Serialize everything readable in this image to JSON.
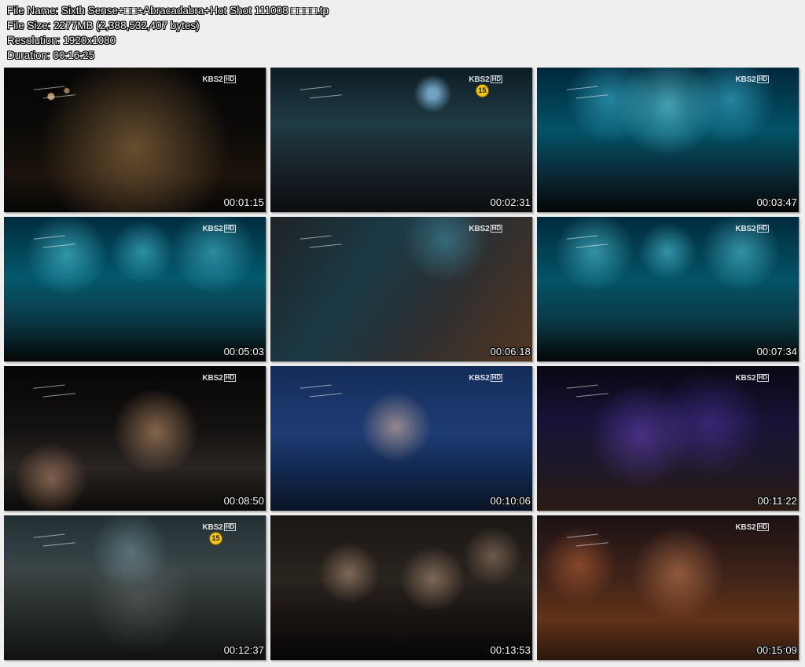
{
  "file_info": {
    "name_line": "File Name: Sixth Sense+□□+Abracadabra+Hot Shot 111008 □□□□.tp",
    "size_line": "File Size: 2277MB (2,388,532,407 bytes)",
    "resolution_line": "Resolution: 1920x1080",
    "duration_line": "Duration: 00:16:25"
  },
  "thumbnails": [
    {
      "timestamp": "00:01:15",
      "channel": "KBS2",
      "hd": "HD",
      "age_rating": "",
      "scene": "dance-stage-dark"
    },
    {
      "timestamp": "00:02:31",
      "channel": "KBS2",
      "hd": "HD",
      "age_rating": "15",
      "scene": "dance-stage-wide"
    },
    {
      "timestamp": "00:03:47",
      "channel": "KBS2",
      "hd": "HD",
      "age_rating": "",
      "scene": "interview-blue"
    },
    {
      "timestamp": "00:05:03",
      "channel": "KBS2",
      "hd": "HD",
      "age_rating": "",
      "scene": "interview-blue-close"
    },
    {
      "timestamp": "00:06:18",
      "channel": "KBS2",
      "hd": "HD",
      "age_rating": "",
      "scene": "interview-side"
    },
    {
      "timestamp": "00:07:34",
      "channel": "KBS2",
      "hd": "HD",
      "age_rating": "",
      "scene": "interview-blue-wide"
    },
    {
      "timestamp": "00:08:50",
      "channel": "KBS2",
      "hd": "HD",
      "age_rating": "",
      "scene": "audience-heart"
    },
    {
      "timestamp": "00:10:06",
      "channel": "KBS2",
      "hd": "HD",
      "age_rating": "",
      "scene": "host-closeup"
    },
    {
      "timestamp": "00:11:22",
      "channel": "KBS2",
      "hd": "HD",
      "age_rating": "",
      "scene": "dance-purple"
    },
    {
      "timestamp": "00:12:37",
      "channel": "KBS2",
      "hd": "HD",
      "age_rating": "15",
      "scene": "dance-closeup"
    },
    {
      "timestamp": "00:13:53",
      "channel": "",
      "hd": "",
      "age_rating": "",
      "scene": "audience-crowd"
    },
    {
      "timestamp": "00:15:09",
      "channel": "KBS2",
      "hd": "HD",
      "age_rating": "",
      "scene": "dance-orange"
    }
  ],
  "colors": {
    "page_background": "#efefef",
    "badge_yellow": "#f3c511"
  }
}
